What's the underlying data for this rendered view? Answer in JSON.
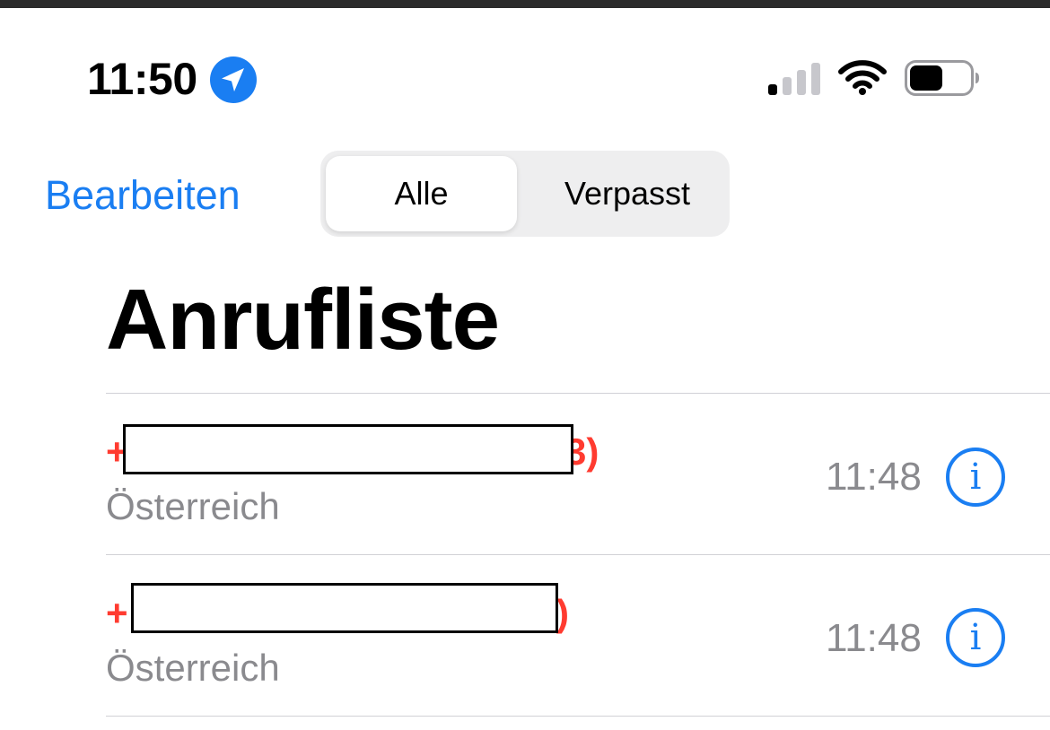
{
  "status_bar": {
    "time": "11:50",
    "location_icon": "location-arrow-icon",
    "signal_icon": "cellular-signal-icon",
    "wifi_icon": "wifi-icon",
    "battery_icon": "battery-icon",
    "signal_level": 0.25,
    "battery_level": 0.5
  },
  "nav": {
    "edit_label": "Bearbeiten",
    "segments": [
      {
        "label": "Alle",
        "selected": true
      },
      {
        "label": "Verpasst",
        "selected": false
      }
    ]
  },
  "page_title": "Anrufliste",
  "calls": [
    {
      "prefix": "+",
      "suffix": "3)",
      "location": "Österreich",
      "time": "11:48",
      "missed": true
    },
    {
      "prefix": "+",
      "suffix": ")",
      "location": "Österreich",
      "time": "11:48",
      "missed": true
    }
  ],
  "colors": {
    "accent": "#1a7ef2",
    "missed": "#ff3b30",
    "secondary_text": "#8a8a8e"
  }
}
